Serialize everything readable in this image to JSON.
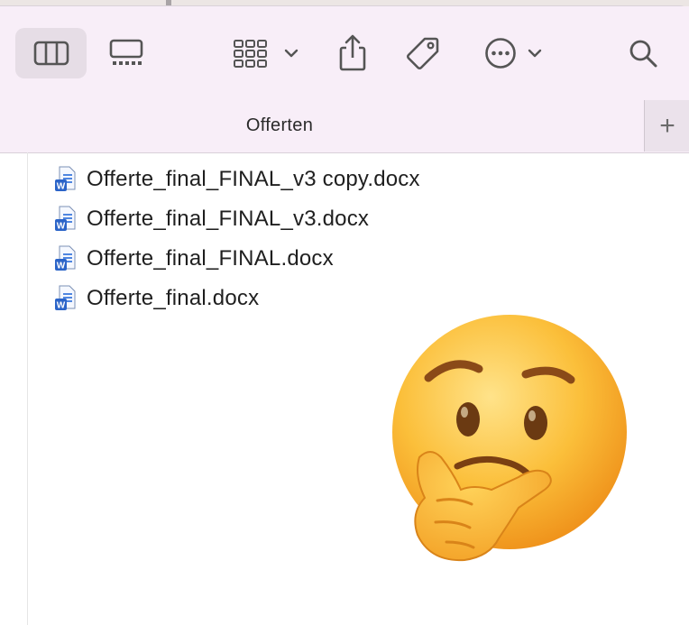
{
  "toolbar": {
    "buttons": [
      {
        "name": "view-columns-button",
        "icon": "columns-icon",
        "active": true
      },
      {
        "name": "view-gallery-button",
        "icon": "gallery-icon"
      },
      {
        "name": "group-button",
        "icon": "grid-icon",
        "dropdown": true
      },
      {
        "name": "share-button",
        "icon": "share-icon"
      },
      {
        "name": "tags-button",
        "icon": "tag-icon"
      },
      {
        "name": "action-button",
        "icon": "ellipsis-icon",
        "dropdown": true
      },
      {
        "name": "search-button",
        "icon": "search-icon"
      }
    ]
  },
  "tab": {
    "title": "Offerten",
    "new_tab_label": "+"
  },
  "files": [
    {
      "name": "Offerte_final_FINAL_v3 copy.docx",
      "icon": "word-document-icon"
    },
    {
      "name": "Offerte_final_FINAL_v3.docx",
      "icon": "word-document-icon"
    },
    {
      "name": "Offerte_final_FINAL.docx",
      "icon": "word-document-icon"
    },
    {
      "name": "Offerte_final.docx",
      "icon": "word-document-icon"
    }
  ],
  "overlay": {
    "emoji": "thinking-face-emoji"
  },
  "colors": {
    "toolbar_bg": "#f8eef8",
    "icon": "#5b5b5b",
    "word_blue": "#2b64c8"
  }
}
